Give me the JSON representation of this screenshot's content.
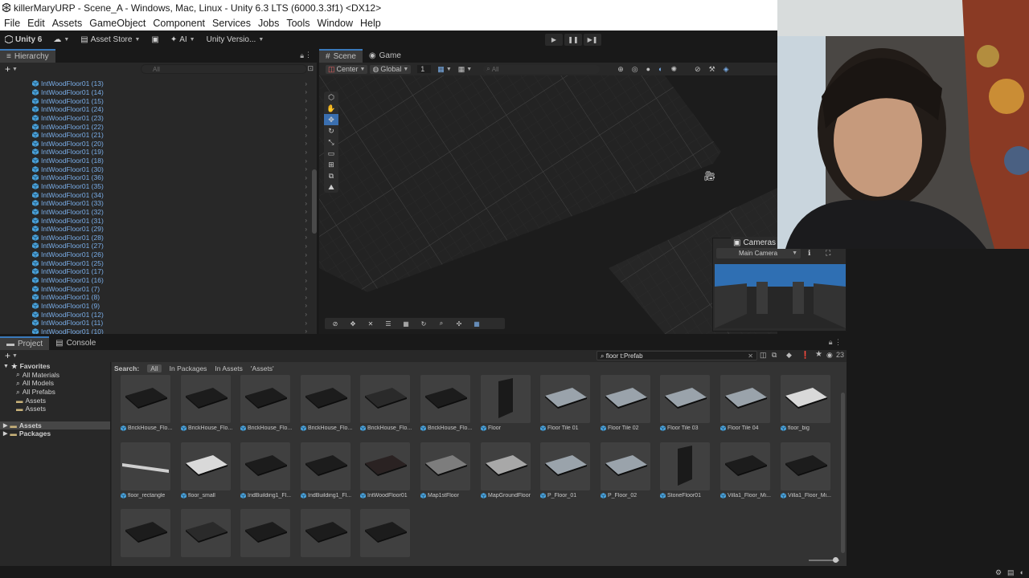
{
  "window": {
    "title": "killerMaryURP - Scene_A - Windows, Mac, Linux - Unity 6.3 LTS (6000.3.3f1) <DX12>"
  },
  "menu": [
    "File",
    "Edit",
    "Assets",
    "GameObject",
    "Component",
    "Services",
    "Jobs",
    "Tools",
    "Window",
    "Help"
  ],
  "toolbar": {
    "unity_label": "Unity 6",
    "asset_store": "Asset Store",
    "ai_label": "AI",
    "version_control": "Unity Versio..."
  },
  "hierarchy": {
    "tab": "Hierarchy",
    "search_placeholder": "All",
    "items": [
      "IntWoodFloor01 (13)",
      "IntWoodFloor01 (14)",
      "IntWoodFloor01 (15)",
      "IntWoodFloor01 (24)",
      "IntWoodFloor01 (23)",
      "IntWoodFloor01 (22)",
      "IntWoodFloor01 (21)",
      "IntWoodFloor01 (20)",
      "IntWoodFloor01 (19)",
      "IntWoodFloor01 (18)",
      "IntWoodFloor01 (30)",
      "IntWoodFloor01 (36)",
      "IntWoodFloor01 (35)",
      "IntWoodFloor01 (34)",
      "IntWoodFloor01 (33)",
      "IntWoodFloor01 (32)",
      "IntWoodFloor01 (31)",
      "IntWoodFloor01 (29)",
      "IntWoodFloor01 (28)",
      "IntWoodFloor01 (27)",
      "IntWoodFloor01 (26)",
      "IntWoodFloor01 (25)",
      "IntWoodFloor01 (17)",
      "IntWoodFloor01 (16)",
      "IntWoodFloor01 (7)",
      "IntWoodFloor01 (8)",
      "IntWoodFloor01 (9)",
      "IntWoodFloor01 (12)",
      "IntWoodFloor01 (11)",
      "IntWoodFloor01 (10)"
    ]
  },
  "scene": {
    "tabs": [
      "Scene",
      "Game"
    ],
    "pivot": "Center",
    "space": "Global",
    "grid_snap": "1",
    "search_placeholder": "All"
  },
  "cameras": {
    "title": "Cameras",
    "selected": "Main Camera"
  },
  "project": {
    "tabs": [
      "Project",
      "Console"
    ],
    "search_value": "floor t:Prefab",
    "count": "23",
    "favorites": {
      "label": "Favorites",
      "items": [
        "All Materials",
        "All Models",
        "All Prefabs",
        "Assets",
        "Assets"
      ]
    },
    "roots": [
      "Assets",
      "Packages"
    ],
    "search_label": "Search:",
    "filters": [
      "All",
      "In Packages",
      "In Assets",
      "'Assets'"
    ],
    "assets": [
      "BrickHouse_Flo...",
      "BrickHouse_Flo...",
      "BrickHouse_Flo...",
      "BrickHouse_Flo...",
      "BrickHouse_Flo...",
      "BrickHouse_Flo...",
      "Floor",
      "Floor Tile 01",
      "Floor Tile 02",
      "Floor Tile 03",
      "Floor Tile 04",
      "floor_big",
      "floor_rectangle",
      "floor_small",
      "IndBuilding1_Fl...",
      "IndBuilding1_Fl...",
      "IntWoodFloor01",
      "Map1stFloor",
      "MapGroundFloor",
      "P_Floor_01",
      "P_Floor_02",
      "StoneFloor01",
      "Villa1_Floor_Mi...",
      "Villa1_Floor_Mi...",
      "",
      "",
      "",
      "",
      ""
    ]
  },
  "colors": {
    "accent": "#3a79bb",
    "hierarchy_text": "#7aaee9",
    "panel": "#282828"
  }
}
